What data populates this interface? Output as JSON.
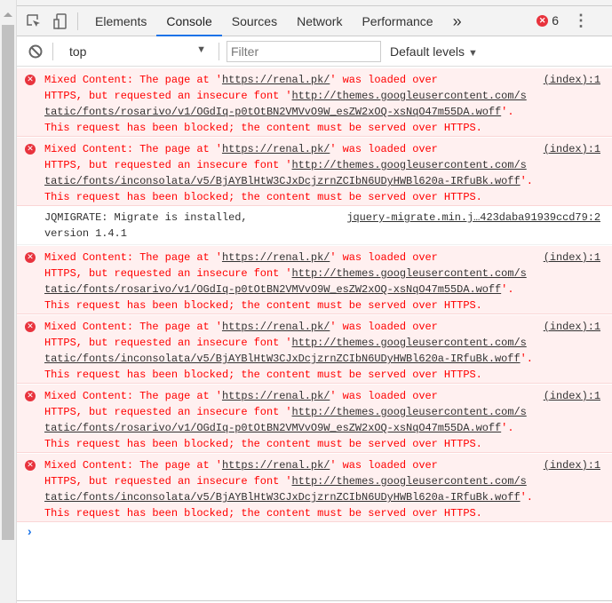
{
  "tabs": [
    {
      "label": "Elements"
    },
    {
      "label": "Console",
      "active": true
    },
    {
      "label": "Sources"
    },
    {
      "label": "Network"
    },
    {
      "label": "Performance"
    }
  ],
  "more_tabs": "»",
  "error_count": "6",
  "toolbar": {
    "context": "top",
    "filter_placeholder": "Filter",
    "levels": "Default levels"
  },
  "colors": {
    "error_text": "#ff0000",
    "error_bg": "#fff0f0",
    "accent": "#1a73e8"
  },
  "messages": [
    {
      "type": "error",
      "pre": "Mixed Content: The page at '",
      "page_url": "https://renal.pk/",
      "mid1": "' was loaded over",
      "mid2": "HTTPS, but requested an insecure font '",
      "font_url_a": "http://themes.googleusercontent.com/s",
      "font_url_b": "tatic/fonts/rosarivo/v1/OGdIq-p0tOtBN2VMVvO9W_esZW2xOQ-xsNqO47m55DA.woff",
      "end": "'.",
      "post": "This request has been blocked; the content must be served over HTTPS.",
      "source": "(index):1"
    },
    {
      "type": "error",
      "pre": "Mixed Content: The page at '",
      "page_url": "https://renal.pk/",
      "mid1": "' was loaded over",
      "mid2": "HTTPS, but requested an insecure font '",
      "font_url_a": "http://themes.googleusercontent.com/s",
      "font_url_b": "tatic/fonts/inconsolata/v5/BjAYBlHtW3CJxDcjzrnZCIbN6UDyHWBl620a-IRfuBk.woff",
      "end": "'.",
      "post": "This request has been blocked; the content must be served over HTTPS.",
      "source": "(index):1"
    },
    {
      "type": "log",
      "line1": "JQMIGRATE: Migrate is installed,",
      "line2": "version 1.4.1",
      "source": "jquery-migrate.min.j…423daba91939ccd79:2"
    },
    {
      "type": "error",
      "pre": "Mixed Content: The page at '",
      "page_url": "https://renal.pk/",
      "mid1": "' was loaded over",
      "mid2": "HTTPS, but requested an insecure font '",
      "font_url_a": "http://themes.googleusercontent.com/s",
      "font_url_b": "tatic/fonts/rosarivo/v1/OGdIq-p0tOtBN2VMVvO9W_esZW2xOQ-xsNqO47m55DA.woff",
      "end": "'.",
      "post": "This request has been blocked; the content must be served over HTTPS.",
      "source": "(index):1"
    },
    {
      "type": "error",
      "pre": "Mixed Content: The page at '",
      "page_url": "https://renal.pk/",
      "mid1": "' was loaded over",
      "mid2": "HTTPS, but requested an insecure font '",
      "font_url_a": "http://themes.googleusercontent.com/s",
      "font_url_b": "tatic/fonts/inconsolata/v5/BjAYBlHtW3CJxDcjzrnZCIbN6UDyHWBl620a-IRfuBk.woff",
      "end": "'.",
      "post": "This request has been blocked; the content must be served over HTTPS.",
      "source": "(index):1"
    },
    {
      "type": "error",
      "pre": "Mixed Content: The page at '",
      "page_url": "https://renal.pk/",
      "mid1": "' was loaded over",
      "mid2": "HTTPS, but requested an insecure font '",
      "font_url_a": "http://themes.googleusercontent.com/s",
      "font_url_b": "tatic/fonts/rosarivo/v1/OGdIq-p0tOtBN2VMVvO9W_esZW2xOQ-xsNqO47m55DA.woff",
      "end": "'.",
      "post": "This request has been blocked; the content must be served over HTTPS.",
      "source": "(index):1"
    },
    {
      "type": "error",
      "pre": "Mixed Content: The page at '",
      "page_url": "https://renal.pk/",
      "mid1": "' was loaded over",
      "mid2": "HTTPS, but requested an insecure font '",
      "font_url_a": "http://themes.googleusercontent.com/s",
      "font_url_b": "tatic/fonts/inconsolata/v5/BjAYBlHtW3CJxDcjzrnZCIbN6UDyHWBl620a-IRfuBk.woff",
      "end": "'.",
      "post": "This request has been blocked; the content must be served over HTTPS.",
      "source": "(index):1"
    }
  ],
  "prompt_symbol": "›"
}
